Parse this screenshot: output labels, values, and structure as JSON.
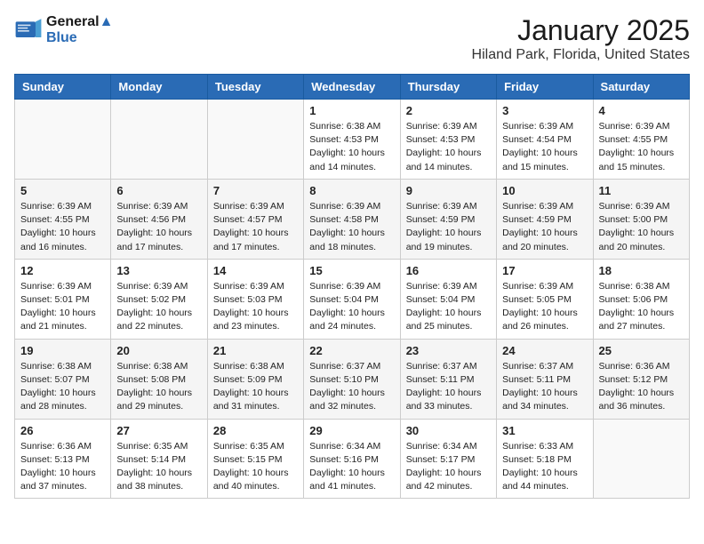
{
  "header": {
    "logo_line1": "General",
    "logo_line2": "Blue",
    "title": "January 2025",
    "subtitle": "Hiland Park, Florida, United States"
  },
  "weekdays": [
    "Sunday",
    "Monday",
    "Tuesday",
    "Wednesday",
    "Thursday",
    "Friday",
    "Saturday"
  ],
  "weeks": [
    [
      {
        "day": "",
        "sunrise": "",
        "sunset": "",
        "daylight": "",
        "empty": true
      },
      {
        "day": "",
        "sunrise": "",
        "sunset": "",
        "daylight": "",
        "empty": true
      },
      {
        "day": "",
        "sunrise": "",
        "sunset": "",
        "daylight": "",
        "empty": true
      },
      {
        "day": "1",
        "sunrise": "Sunrise: 6:38 AM",
        "sunset": "Sunset: 4:53 PM",
        "daylight": "Daylight: 10 hours and 14 minutes."
      },
      {
        "day": "2",
        "sunrise": "Sunrise: 6:39 AM",
        "sunset": "Sunset: 4:53 PM",
        "daylight": "Daylight: 10 hours and 14 minutes."
      },
      {
        "day": "3",
        "sunrise": "Sunrise: 6:39 AM",
        "sunset": "Sunset: 4:54 PM",
        "daylight": "Daylight: 10 hours and 15 minutes."
      },
      {
        "day": "4",
        "sunrise": "Sunrise: 6:39 AM",
        "sunset": "Sunset: 4:55 PM",
        "daylight": "Daylight: 10 hours and 15 minutes."
      }
    ],
    [
      {
        "day": "5",
        "sunrise": "Sunrise: 6:39 AM",
        "sunset": "Sunset: 4:55 PM",
        "daylight": "Daylight: 10 hours and 16 minutes."
      },
      {
        "day": "6",
        "sunrise": "Sunrise: 6:39 AM",
        "sunset": "Sunset: 4:56 PM",
        "daylight": "Daylight: 10 hours and 17 minutes."
      },
      {
        "day": "7",
        "sunrise": "Sunrise: 6:39 AM",
        "sunset": "Sunset: 4:57 PM",
        "daylight": "Daylight: 10 hours and 17 minutes."
      },
      {
        "day": "8",
        "sunrise": "Sunrise: 6:39 AM",
        "sunset": "Sunset: 4:58 PM",
        "daylight": "Daylight: 10 hours and 18 minutes."
      },
      {
        "day": "9",
        "sunrise": "Sunrise: 6:39 AM",
        "sunset": "Sunset: 4:59 PM",
        "daylight": "Daylight: 10 hours and 19 minutes."
      },
      {
        "day": "10",
        "sunrise": "Sunrise: 6:39 AM",
        "sunset": "Sunset: 4:59 PM",
        "daylight": "Daylight: 10 hours and 20 minutes."
      },
      {
        "day": "11",
        "sunrise": "Sunrise: 6:39 AM",
        "sunset": "Sunset: 5:00 PM",
        "daylight": "Daylight: 10 hours and 20 minutes."
      }
    ],
    [
      {
        "day": "12",
        "sunrise": "Sunrise: 6:39 AM",
        "sunset": "Sunset: 5:01 PM",
        "daylight": "Daylight: 10 hours and 21 minutes."
      },
      {
        "day": "13",
        "sunrise": "Sunrise: 6:39 AM",
        "sunset": "Sunset: 5:02 PM",
        "daylight": "Daylight: 10 hours and 22 minutes."
      },
      {
        "day": "14",
        "sunrise": "Sunrise: 6:39 AM",
        "sunset": "Sunset: 5:03 PM",
        "daylight": "Daylight: 10 hours and 23 minutes."
      },
      {
        "day": "15",
        "sunrise": "Sunrise: 6:39 AM",
        "sunset": "Sunset: 5:04 PM",
        "daylight": "Daylight: 10 hours and 24 minutes."
      },
      {
        "day": "16",
        "sunrise": "Sunrise: 6:39 AM",
        "sunset": "Sunset: 5:04 PM",
        "daylight": "Daylight: 10 hours and 25 minutes."
      },
      {
        "day": "17",
        "sunrise": "Sunrise: 6:39 AM",
        "sunset": "Sunset: 5:05 PM",
        "daylight": "Daylight: 10 hours and 26 minutes."
      },
      {
        "day": "18",
        "sunrise": "Sunrise: 6:38 AM",
        "sunset": "Sunset: 5:06 PM",
        "daylight": "Daylight: 10 hours and 27 minutes."
      }
    ],
    [
      {
        "day": "19",
        "sunrise": "Sunrise: 6:38 AM",
        "sunset": "Sunset: 5:07 PM",
        "daylight": "Daylight: 10 hours and 28 minutes."
      },
      {
        "day": "20",
        "sunrise": "Sunrise: 6:38 AM",
        "sunset": "Sunset: 5:08 PM",
        "daylight": "Daylight: 10 hours and 29 minutes."
      },
      {
        "day": "21",
        "sunrise": "Sunrise: 6:38 AM",
        "sunset": "Sunset: 5:09 PM",
        "daylight": "Daylight: 10 hours and 31 minutes."
      },
      {
        "day": "22",
        "sunrise": "Sunrise: 6:37 AM",
        "sunset": "Sunset: 5:10 PM",
        "daylight": "Daylight: 10 hours and 32 minutes."
      },
      {
        "day": "23",
        "sunrise": "Sunrise: 6:37 AM",
        "sunset": "Sunset: 5:11 PM",
        "daylight": "Daylight: 10 hours and 33 minutes."
      },
      {
        "day": "24",
        "sunrise": "Sunrise: 6:37 AM",
        "sunset": "Sunset: 5:11 PM",
        "daylight": "Daylight: 10 hours and 34 minutes."
      },
      {
        "day": "25",
        "sunrise": "Sunrise: 6:36 AM",
        "sunset": "Sunset: 5:12 PM",
        "daylight": "Daylight: 10 hours and 36 minutes."
      }
    ],
    [
      {
        "day": "26",
        "sunrise": "Sunrise: 6:36 AM",
        "sunset": "Sunset: 5:13 PM",
        "daylight": "Daylight: 10 hours and 37 minutes."
      },
      {
        "day": "27",
        "sunrise": "Sunrise: 6:35 AM",
        "sunset": "Sunset: 5:14 PM",
        "daylight": "Daylight: 10 hours and 38 minutes."
      },
      {
        "day": "28",
        "sunrise": "Sunrise: 6:35 AM",
        "sunset": "Sunset: 5:15 PM",
        "daylight": "Daylight: 10 hours and 40 minutes."
      },
      {
        "day": "29",
        "sunrise": "Sunrise: 6:34 AM",
        "sunset": "Sunset: 5:16 PM",
        "daylight": "Daylight: 10 hours and 41 minutes."
      },
      {
        "day": "30",
        "sunrise": "Sunrise: 6:34 AM",
        "sunset": "Sunset: 5:17 PM",
        "daylight": "Daylight: 10 hours and 42 minutes."
      },
      {
        "day": "31",
        "sunrise": "Sunrise: 6:33 AM",
        "sunset": "Sunset: 5:18 PM",
        "daylight": "Daylight: 10 hours and 44 minutes."
      },
      {
        "day": "",
        "sunrise": "",
        "sunset": "",
        "daylight": "",
        "empty": true
      }
    ]
  ]
}
